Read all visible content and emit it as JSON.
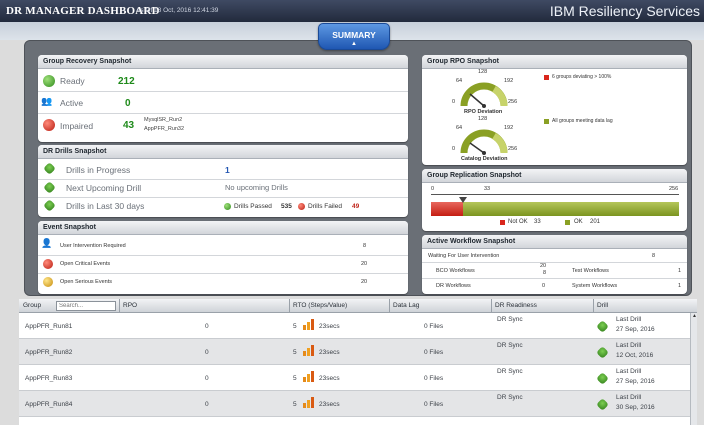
{
  "header": {
    "title": "DR MANAGER DASHBOARD",
    "asof": "As Of 18 Oct, 2016 12:41:39",
    "brand": "IBM Resiliency Services"
  },
  "summary_tab": {
    "label": "SUMMARY"
  },
  "group_recovery": {
    "title": "Group Recovery Snapshot",
    "ready_label": "Ready",
    "ready_count": "212",
    "active_label": "Active",
    "active_count": "0",
    "impaired_label": "Impaired",
    "impaired_count": "43",
    "impaired_items": [
      "MysqlSR_Run2",
      "AppPFR_Run32"
    ]
  },
  "dr_drills": {
    "title": "DR Drills Snapshot",
    "in_progress_label": "Drills in Progress",
    "in_progress_value": "1",
    "next_label": "Next Upcoming Drill",
    "next_value": "No upcoming Drills",
    "last30_label": "Drills in Last 30 days",
    "passed_label": "Drills Passed",
    "passed_value": "535",
    "failed_label": "Drills Failed",
    "failed_value": "49"
  },
  "event": {
    "title": "Event Snapshot",
    "rows": [
      {
        "label": "User Intervention Required",
        "value": "8"
      },
      {
        "label": "Open Critical Events",
        "value": "20"
      },
      {
        "label": "Open Serious Events",
        "value": "20"
      }
    ]
  },
  "rpo": {
    "title": "Group RPO Snapshot",
    "gauge1": {
      "caption": "RPO Deviation",
      "ticks": [
        "0",
        "64",
        "128",
        "192",
        "256"
      ]
    },
    "gauge2": {
      "caption": "Catalog Deviation",
      "ticks": [
        "0",
        "64",
        "128",
        "192",
        "256"
      ]
    },
    "legend1": "6 groups deviating > 100%",
    "legend2": "All groups meeting data lag",
    "colors": {
      "red": "#d9261c",
      "olive": "#8aa024"
    }
  },
  "replication": {
    "title": "Group Replication Snapshot",
    "axis": [
      "0",
      "33",
      "256"
    ],
    "not_ok_label": "Not OK",
    "not_ok_value": "33",
    "ok_label": "OK",
    "ok_value": "201",
    "marker": 33,
    "total": 256
  },
  "workflow": {
    "title": "Active Workflow Snapshot",
    "waiting_label": "Waiting For User Intervention",
    "waiting_value": "8",
    "bco_label": "BCO Workflows",
    "bco_value": "20",
    "bco_value2": "8",
    "test_label": "Test Workflows",
    "test_value": "1",
    "dr_label": "DR Workflows",
    "dr_value": "0",
    "system_label": "System Workflows",
    "system_value": "1"
  },
  "grid": {
    "columns": [
      "Group",
      "RPO",
      "RTO (Steps/Value)",
      "Data Lag",
      "DR Readiness",
      "Drill"
    ],
    "search_placeholder": "Search...",
    "rows": [
      {
        "group": "AppPFR_Run81",
        "rpo": "0",
        "steps": "5",
        "value": "23secs",
        "lag": "0 Files",
        "readiness": "DR Sync",
        "drill_label": "Last Drill",
        "drill_date": "27 Sep, 2016"
      },
      {
        "group": "AppPFR_Run82",
        "rpo": "0",
        "steps": "5",
        "value": "23secs",
        "lag": "0 Files",
        "readiness": "DR Sync",
        "drill_label": "Last Drill",
        "drill_date": "12 Oct, 2016"
      },
      {
        "group": "AppPFR_Run83",
        "rpo": "0",
        "steps": "5",
        "value": "23secs",
        "lag": "0 Files",
        "readiness": "DR Sync",
        "drill_label": "Last Drill",
        "drill_date": "27 Sep, 2016"
      },
      {
        "group": "AppPFR_Run84",
        "rpo": "0",
        "steps": "5",
        "value": "23secs",
        "lag": "0 Files",
        "readiness": "DR Sync",
        "drill_label": "Last Drill",
        "drill_date": "30 Sep, 2016"
      }
    ]
  }
}
